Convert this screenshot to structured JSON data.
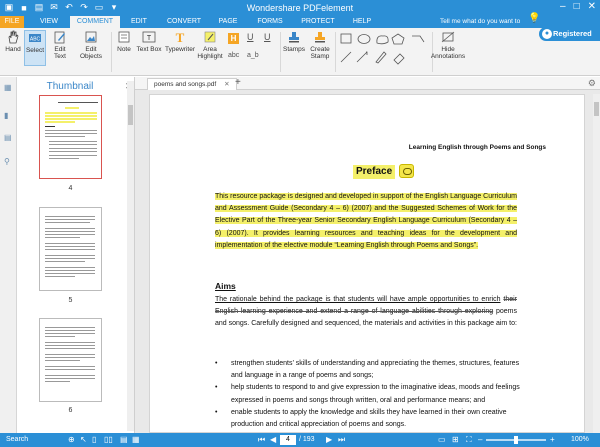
{
  "app": {
    "title": "Wondershare PDFelement",
    "registered_label": "Registered",
    "tell_me_placeholder": "Tell me what do you want to do..."
  },
  "menu_tabs": [
    {
      "label": "FILE"
    },
    {
      "label": "VIEW"
    },
    {
      "label": "COMMENT"
    },
    {
      "label": "EDIT"
    },
    {
      "label": "CONVERT"
    },
    {
      "label": "PAGE"
    },
    {
      "label": "FORMS"
    },
    {
      "label": "PROTECT"
    },
    {
      "label": "HELP"
    }
  ],
  "ribbon": {
    "hand": "Hand",
    "select": "Select",
    "edit_text": "Edit Text",
    "edit_objects": "Edit Objects",
    "note": "Note",
    "text_box": "Text Box",
    "typewriter": "Typewriter",
    "area_highlight_1": "Area",
    "area_highlight_2": "Highlight",
    "stamps": "Stamps",
    "create_stamp_1": "Create",
    "create_stamp_2": "Stamp",
    "hide_annotations_1": "Hide",
    "hide_annotations_2": "Annotations",
    "abc": "abc",
    "a_b": "a_b"
  },
  "thumbnails": {
    "title": "Thumbnail",
    "pages": [
      "4",
      "5",
      "6"
    ]
  },
  "document": {
    "tab_name": "poems and songs.pdf",
    "header_right": "Learning English through Poems and Songs",
    "heading": "Preface",
    "preface_text": "This resource package is designed and developed in support of the English Language Curriculum and Assessment Guide (Secondary 4 – 6) (2007) and the Suggested Schemes of Work for the Elective Part of the Three-year Senior Secondary English Language Curriculum (Secondary 4 – 6) (2007). It provides learning resources and teaching ideas for the development and implementation of the elective module “Learning English through Poems and Songs”.",
    "aims_heading": "Aims",
    "aims_line1": "The rationale behind the package is that students will have ample opportunities to enrich",
    "aims_line2": "their English learning experience and extend a range of language abilities through exploring",
    "aims_rest": "poems and songs. Carefully designed and sequenced, the materials and activities in this package aim to:",
    "bullets": [
      "strengthen students’ skills of understanding and appreciating the themes, structures, features and language in a range of poems and songs;",
      "help students to respond to and give expression to the imaginative ideas, moods and feelings expressed in poems and songs through written, oral and performance means; and",
      "enable students to apply the knowledge and skills they have learned in their own creative production and critical appreciation of poems and songs."
    ]
  },
  "status": {
    "search_label": "Search",
    "current_page": "4",
    "page_count": "/ 193",
    "zoom": "100%"
  },
  "colors": {
    "accent": "#2b8fd6",
    "file_tab": "#f5a524",
    "highlight": "#f4f06a"
  }
}
